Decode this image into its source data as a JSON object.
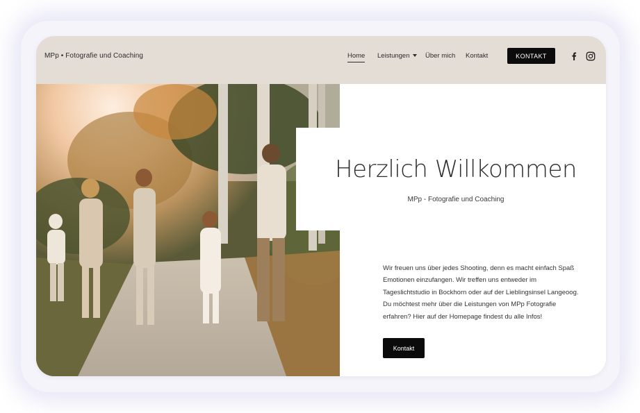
{
  "header": {
    "brand": "MPp • Fotografie und Coaching",
    "nav": {
      "home": "Home",
      "leistungen": "Leistungen",
      "uebermich": "Über mich",
      "kontakt": "Kontakt"
    },
    "cta_label": "KONTAKT",
    "social": [
      "facebook-icon",
      "instagram-icon"
    ]
  },
  "hero": {
    "image": "family-running-photo"
  },
  "content": {
    "headline": "Herzlich Willkommen",
    "subheadline": "MPp - Fotografie und Coaching",
    "body_lines": [
      "Wir freuen uns über jedes Shooting, denn es macht einfach Spaß",
      "Emotionen einzufangen. Wir treffen uns entweder  im",
      "Tageslichtstudio in Bockhorn oder auf der Lieblingsinsel Langeoog.",
      "Du möchtest mehr über die Leistungen von MPp Fotografie",
      "erfahren? Hier auf der Homepage findest du alle Infos!"
    ],
    "button_label": "Kontakt"
  },
  "colors": {
    "header_bg": "#e4ddd6",
    "button_bg": "#0b0b0b",
    "text": "#2d2d2d"
  }
}
